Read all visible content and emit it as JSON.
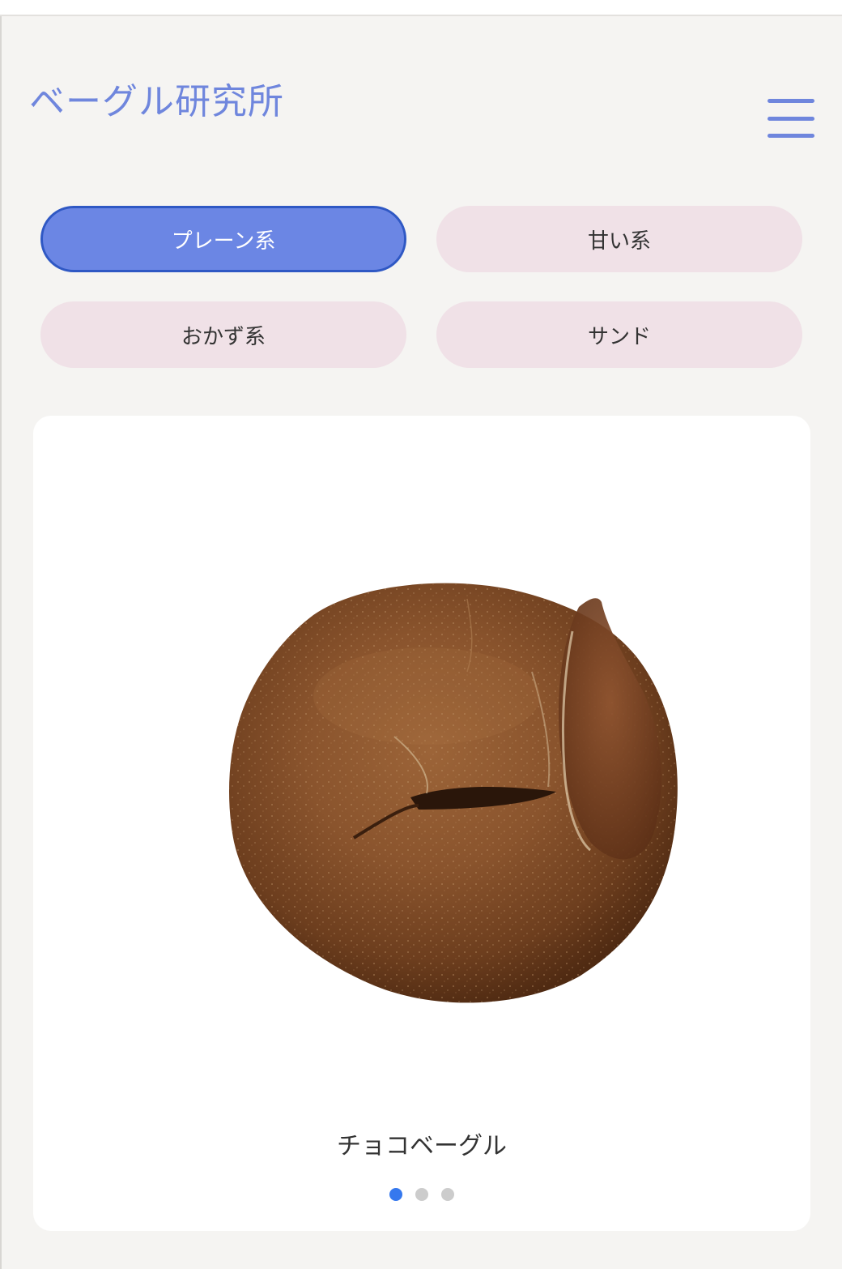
{
  "header": {
    "site_title": "ベーグル研究所",
    "menu_icon": "hamburger-menu-icon"
  },
  "categories": [
    {
      "label": "プレーン系",
      "active": true
    },
    {
      "label": "甘い系",
      "active": false
    },
    {
      "label": "おかず系",
      "active": false
    },
    {
      "label": "サンド",
      "active": false
    }
  ],
  "carousel": {
    "image": "chocolate-bagel-photo",
    "product_name": "チョコベーグル",
    "slide_count": 3,
    "current_slide": 1
  },
  "colors": {
    "brand": "#6f86dd",
    "active_button": "#6b86e4",
    "inactive_button": "#f0e1e7",
    "active_dot": "#3578ee"
  }
}
